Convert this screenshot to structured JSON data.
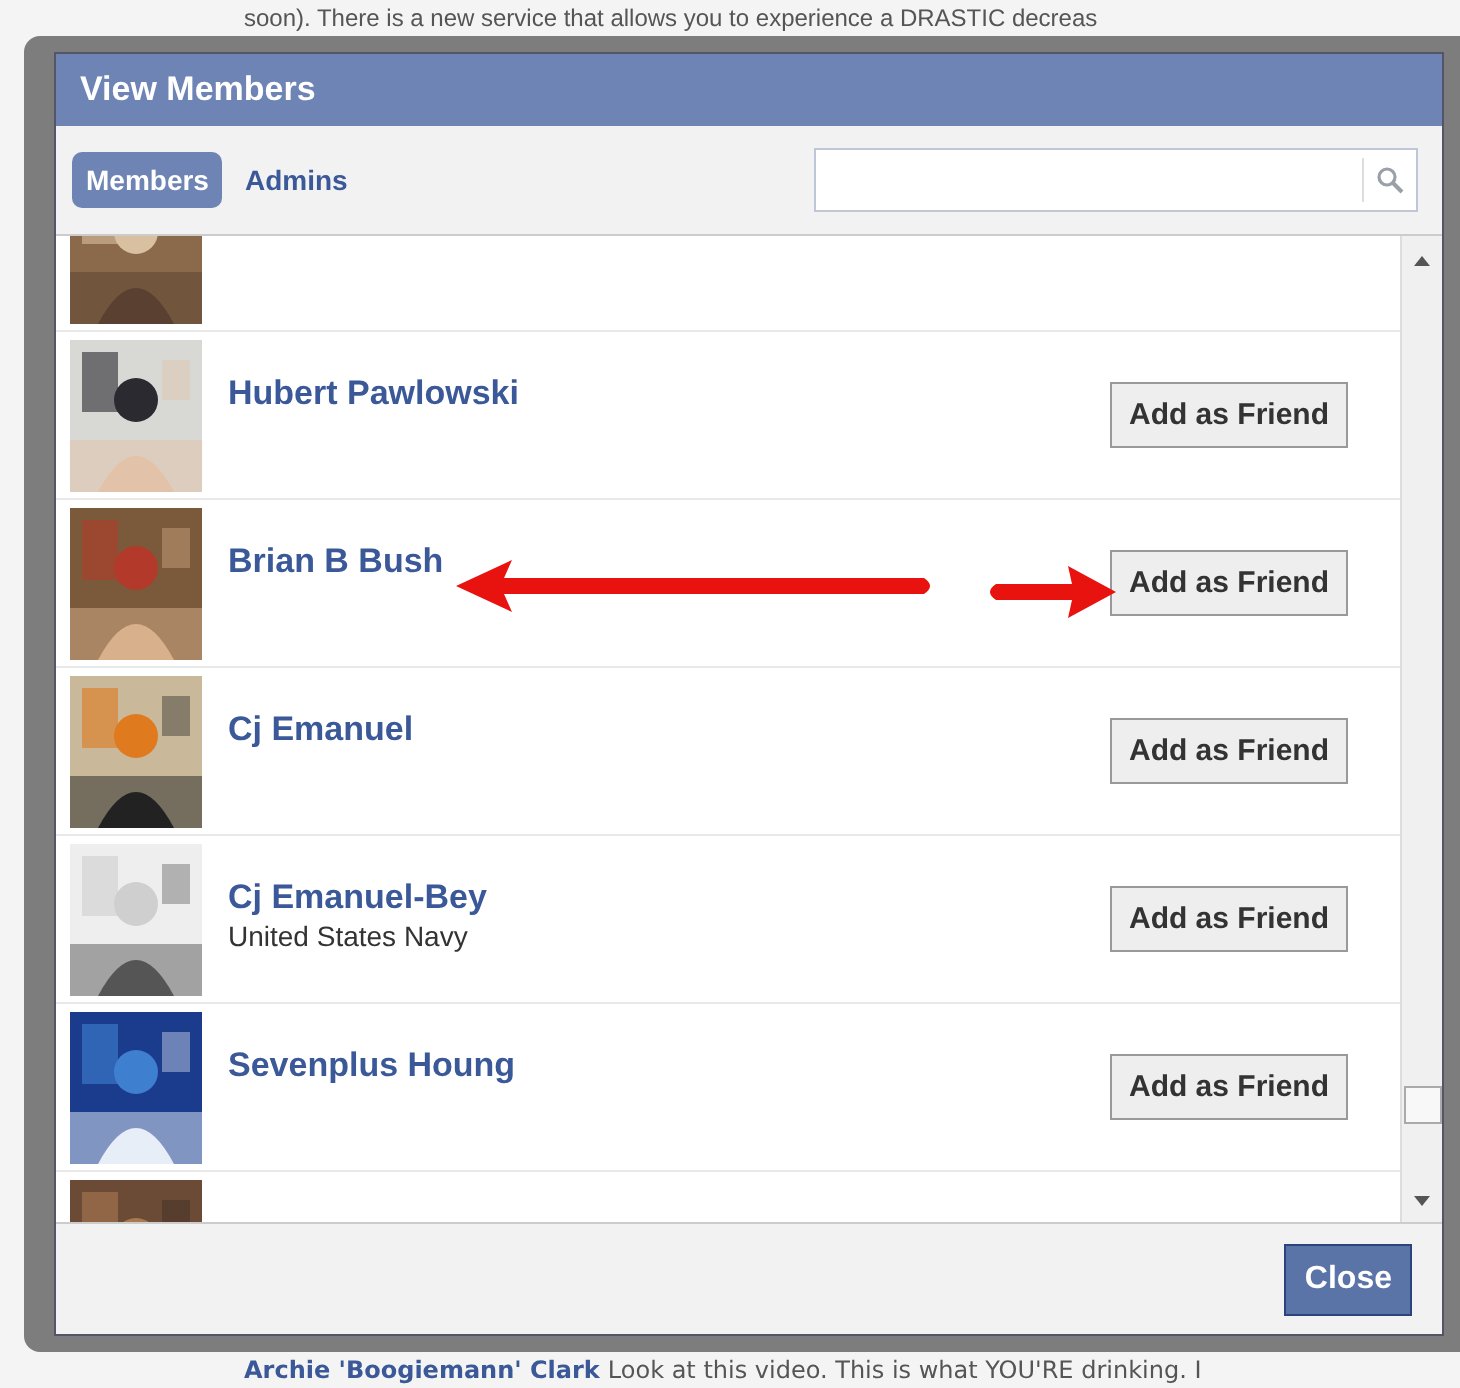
{
  "page_behind": {
    "top_text": "soon). There is a new service that allows you to experience a DRASTIC decreas",
    "bottom_author": "Archie 'Boogiemann' Clark",
    "bottom_text": "Look at this video. This is what YOU'RE drinking. I"
  },
  "dialog": {
    "title": "View Members",
    "tabs": [
      {
        "label": "Members",
        "selected": true
      },
      {
        "label": "Admins",
        "selected": false
      }
    ],
    "rows": [
      {
        "name": "Hubert Pawlowski",
        "button": "Add as Friend"
      },
      {
        "name": "Brian B Bush",
        "button": "Add as Friend"
      },
      {
        "name": "Cj Emanuel",
        "button": "Add as Friend"
      },
      {
        "name": "Cj Emanuel-Bey",
        "subtitle": "United States Navy",
        "button": "Add as Friend"
      },
      {
        "name": "Sevenplus Houng",
        "button": "Add as Friend"
      }
    ],
    "close_button": "Close"
  },
  "annotations": [
    {
      "kind": "leftarrow"
    },
    {
      "kind": "rightarrow"
    }
  ]
}
